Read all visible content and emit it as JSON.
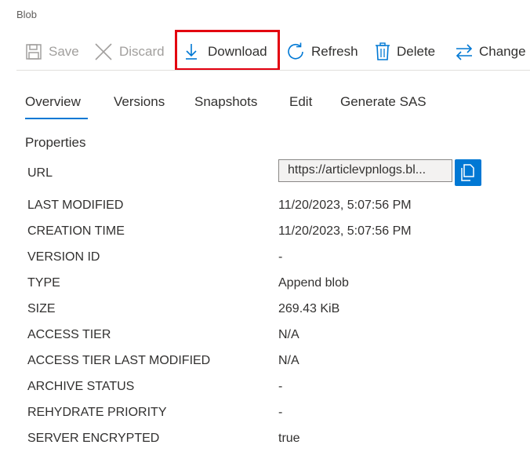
{
  "header": {
    "title_fragment": "",
    "subtitle": "Blob"
  },
  "toolbar": {
    "save_label": "Save",
    "discard_label": "Discard",
    "download_label": "Download",
    "refresh_label": "Refresh",
    "delete_label": "Delete",
    "change_label": "Change"
  },
  "tabs": [
    {
      "label": "Overview"
    },
    {
      "label": "Versions"
    },
    {
      "label": "Snapshots"
    },
    {
      "label": "Edit"
    },
    {
      "label": "Generate SAS"
    }
  ],
  "properties": {
    "section_title": "Properties",
    "url_label": "URL",
    "url_value": "https://articlevpnlogs.bl...",
    "rows": [
      {
        "label": "LAST MODIFIED",
        "value": "11/20/2023, 5:07:56 PM"
      },
      {
        "label": "CREATION TIME",
        "value": "11/20/2023, 5:07:56 PM"
      },
      {
        "label": "VERSION ID",
        "value": "-"
      },
      {
        "label": "TYPE",
        "value": "Append blob"
      },
      {
        "label": "SIZE",
        "value": "269.43 KiB"
      },
      {
        "label": "ACCESS TIER",
        "value": "N/A"
      },
      {
        "label": "ACCESS TIER LAST MODIFIED",
        "value": "N/A"
      },
      {
        "label": "ARCHIVE STATUS",
        "value": "-"
      },
      {
        "label": "REHYDRATE PRIORITY",
        "value": "-"
      },
      {
        "label": "SERVER ENCRYPTED",
        "value": "true"
      }
    ]
  },
  "colors": {
    "accent": "#0078d4",
    "highlight": "#e3000f",
    "disabled": "#a19f9d"
  },
  "icons": [
    "save-icon",
    "discard-icon",
    "download-icon",
    "refresh-icon",
    "delete-icon",
    "change-icon",
    "copy-icon"
  ]
}
